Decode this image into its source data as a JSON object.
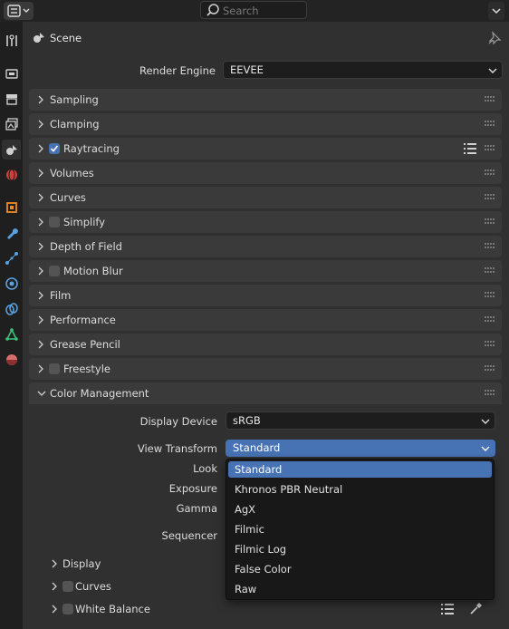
{
  "header": {
    "search_placeholder": "Search"
  },
  "context": {
    "title": "Scene"
  },
  "render_engine": {
    "label": "Render Engine",
    "value": "EEVEE"
  },
  "panels": [
    {
      "label": "Sampling",
      "checkbox": null
    },
    {
      "label": "Clamping",
      "checkbox": null
    },
    {
      "label": "Raytracing",
      "checkbox": true
    },
    {
      "label": "Volumes",
      "checkbox": null
    },
    {
      "label": "Curves",
      "checkbox": null
    },
    {
      "label": "Simplify",
      "checkbox": false
    },
    {
      "label": "Depth of Field",
      "checkbox": null
    },
    {
      "label": "Motion Blur",
      "checkbox": false
    },
    {
      "label": "Film",
      "checkbox": null
    },
    {
      "label": "Performance",
      "checkbox": null
    },
    {
      "label": "Grease Pencil",
      "checkbox": null
    },
    {
      "label": "Freestyle",
      "checkbox": false
    }
  ],
  "color_management": {
    "label": "Color Management",
    "display_device_label": "Display Device",
    "display_device_value": "sRGB",
    "view_transform_label": "View Transform",
    "view_transform_value": "Standard",
    "look_label": "Look",
    "exposure_label": "Exposure",
    "gamma_label": "Gamma",
    "sequencer_label": "Sequencer",
    "subpanels": [
      {
        "label": "Display",
        "checkbox": null
      },
      {
        "label": "Curves",
        "checkbox": false
      },
      {
        "label": "White Balance",
        "checkbox": false
      }
    ]
  },
  "view_transform_menu": {
    "options": [
      "Standard",
      "Khronos PBR Neutral",
      "AgX",
      "Filmic",
      "Filmic Log",
      "False Color",
      "Raw"
    ],
    "selected": "Standard"
  },
  "colors": {
    "accent": "#4772b3",
    "panel": "#3a3a3a",
    "background": "#303030"
  },
  "icons": {
    "tabs": [
      "tool-icon",
      "render-icon",
      "output-icon",
      "view-layer-icon",
      "scene-icon",
      "world-icon",
      "object-icon",
      "modifier-icon",
      "particles-icon",
      "physics-icon",
      "constraints-icon",
      "data-icon",
      "material-icon"
    ]
  }
}
